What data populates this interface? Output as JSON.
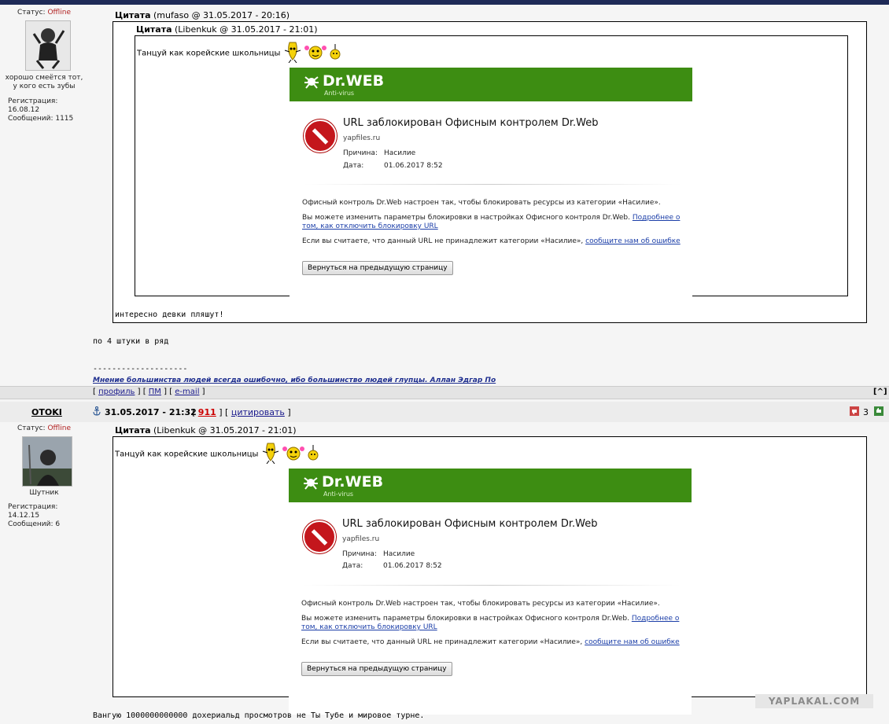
{
  "post1": {
    "status_label": "Статус:",
    "status_value": "Offline",
    "user_title": "хорошо смеётся тот, у кого есть зубы",
    "registration": "Регистрация: 16.08.12",
    "messages": "Сообщений: 1115",
    "outer_quote_label": "Цитата",
    "outer_quote_meta": "(mufaso @ 31.05.2017 - 20:16)",
    "inner_quote_label": "Цитата",
    "inner_quote_meta": "(Libenkuk @ 31.05.2017 - 21:01)",
    "inner_text": "Танцуй как корейские школьницы",
    "outer_text": "интересно девки пляшут!",
    "body_text": "по 4 штуки в ряд",
    "sig_sep": "--------------------",
    "signature": "Мнение большинства людей всегда ошибочно, ибо большинство людей глупцы. Аллан Эдгар По"
  },
  "postbar1": {
    "profile": "профиль",
    "pm": "ПМ",
    "email": "e-mail",
    "top": "[^]"
  },
  "post2": {
    "username": "OTOKI",
    "datetime": "31.05.2017 - 21:32",
    "post_num": "911",
    "quote_btn": "цитировать",
    "rating": "3",
    "status_label": "Статус:",
    "status_value": "Offline",
    "user_title": "Шутник",
    "registration": "Регистрация: 14.12.15",
    "messages": "Сообщений: 6",
    "quote_label": "Цитата",
    "quote_meta": "(Libenkuk @ 31.05.2017 - 21:01)",
    "quote_text": "Танцуй как корейские школьницы",
    "body_text": "Вангую 1000000000000 дохериальд просмотров не Ты Тубе и мировое турне.",
    "watermark": "YAPLAKAL.COM"
  },
  "drweb": {
    "logo": "Dr.WEB",
    "logo_sub": "Anti-virus",
    "title": "URL заблокирован Офисным контролем Dr.Web",
    "host": "yapfiles.ru",
    "reason_label": "Причина:",
    "reason_value": "Насилие",
    "date_label": "Дата:",
    "date_value": "01.06.2017 8:52",
    "p1": "Офисный контроль Dr.Web настроен так, чтобы блокировать ресурсы из категории «Насилие».",
    "p2_text": "Вы можете изменить параметры блокировки в настройках Офисного контроля Dr.Web.",
    "p2_link": "Подробнее о том, как отключить блокировку URL",
    "p3_text": "Если вы считаете, что данный URL не принадлежит категории «Насилие»,",
    "p3_link": "сообщите нам об ошибке",
    "button": "Вернуться на предыдущую страницу"
  }
}
